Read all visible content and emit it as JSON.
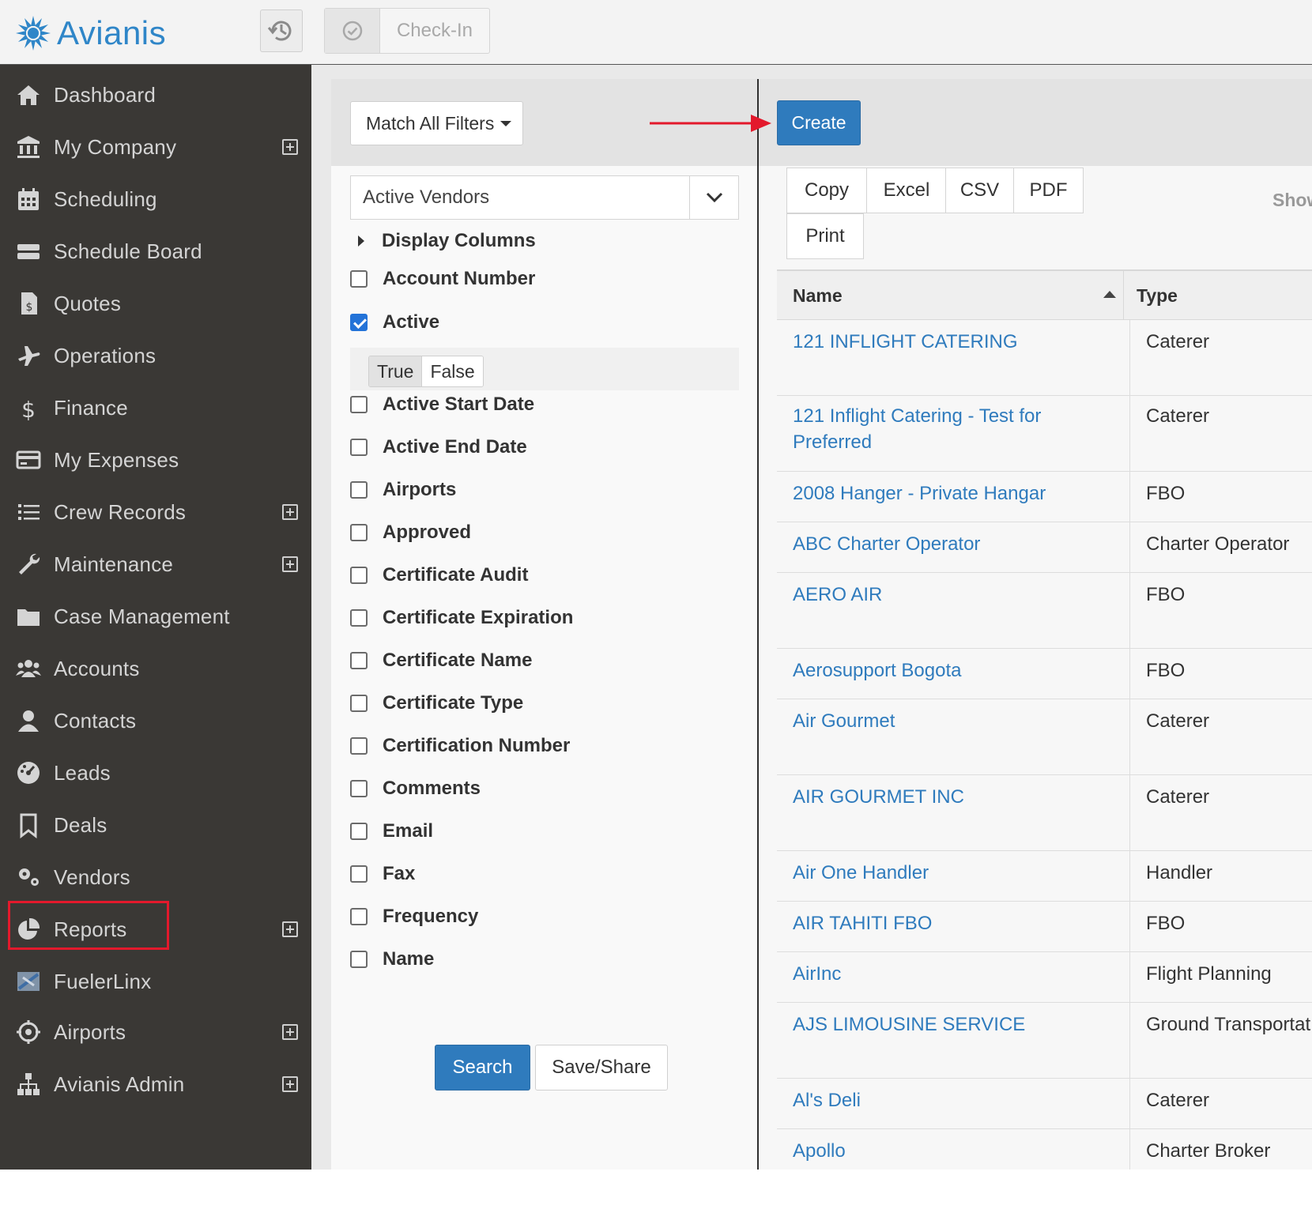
{
  "header": {
    "logo_text": "Avianis",
    "history_icon": "history-icon",
    "checkin_label": "Check-In"
  },
  "sidebar": {
    "items": [
      {
        "label": "Dashboard",
        "icon": "home-icon",
        "expandable": false
      },
      {
        "label": "My Company",
        "icon": "bank-icon",
        "expandable": true
      },
      {
        "label": "Scheduling",
        "icon": "calendar-icon",
        "expandable": false
      },
      {
        "label": "Schedule Board",
        "icon": "server-icon",
        "expandable": false
      },
      {
        "label": "Quotes",
        "icon": "invoice-icon",
        "expandable": false
      },
      {
        "label": "Operations",
        "icon": "plane-icon",
        "expandable": false
      },
      {
        "label": "Finance",
        "icon": "dollar-icon",
        "expandable": false
      },
      {
        "label": "My Expenses",
        "icon": "credit-card-icon",
        "expandable": false
      },
      {
        "label": "Crew Records",
        "icon": "list-icon",
        "expandable": true
      },
      {
        "label": "Maintenance",
        "icon": "wrench-icon",
        "expandable": true
      },
      {
        "label": "Case Management",
        "icon": "folder-icon",
        "expandable": false
      },
      {
        "label": "Accounts",
        "icon": "users-icon",
        "expandable": false
      },
      {
        "label": "Contacts",
        "icon": "user-icon",
        "expandable": false
      },
      {
        "label": "Leads",
        "icon": "gauge-icon",
        "expandable": false
      },
      {
        "label": "Deals",
        "icon": "bookmark-icon",
        "expandable": false
      },
      {
        "label": "Vendors",
        "icon": "cogs-icon",
        "expandable": false
      },
      {
        "label": "Reports",
        "icon": "pie-chart-icon",
        "expandable": true
      },
      {
        "label": "FuelerLinx",
        "icon": "fuelerlinx-icon",
        "expandable": false
      },
      {
        "label": "Airports",
        "icon": "crosshair-icon",
        "expandable": true
      },
      {
        "label": "Avianis Admin",
        "icon": "sitemap-icon",
        "expandable": true
      }
    ]
  },
  "filters": {
    "match_label": "Match All Filters",
    "view_select": "Active Vendors",
    "display_columns_label": "Display Columns",
    "fields": [
      {
        "label": "Account Number",
        "checked": false
      },
      {
        "label": "Active",
        "checked": true
      },
      {
        "label": "Active Start Date",
        "checked": false
      },
      {
        "label": "Active End Date",
        "checked": false
      },
      {
        "label": "Airports",
        "checked": false
      },
      {
        "label": "Approved",
        "checked": false
      },
      {
        "label": "Certificate Audit",
        "checked": false
      },
      {
        "label": "Certificate Expiration",
        "checked": false
      },
      {
        "label": "Certificate Name",
        "checked": false
      },
      {
        "label": "Certificate Type",
        "checked": false
      },
      {
        "label": "Certification Number",
        "checked": false
      },
      {
        "label": "Comments",
        "checked": false
      },
      {
        "label": "Email",
        "checked": false
      },
      {
        "label": "Fax",
        "checked": false
      },
      {
        "label": "Frequency",
        "checked": false
      },
      {
        "label": "Name",
        "checked": false
      }
    ],
    "active_options": {
      "true_label": "True",
      "false_label": "False",
      "selected": "True"
    },
    "search_label": "Search",
    "save_share_label": "Save/Share"
  },
  "toolbar": {
    "create_label": "Create",
    "export_buttons": [
      "Copy",
      "Excel",
      "CSV",
      "PDF",
      "Print"
    ],
    "show_label": "Show"
  },
  "table": {
    "columns": [
      "Name",
      "Type"
    ],
    "rows": [
      {
        "name": "121 INFLIGHT CATERING",
        "type": "Caterer"
      },
      {
        "name": "121 Inflight Catering - Test for Preferred",
        "type": "Caterer"
      },
      {
        "name": "2008 Hanger - Private Hangar",
        "type": "FBO"
      },
      {
        "name": "ABC Charter Operator",
        "type": "Charter Operator"
      },
      {
        "name": "AERO AIR",
        "type": "FBO"
      },
      {
        "name": "Aerosupport Bogota",
        "type": "FBO"
      },
      {
        "name": "Air Gourmet",
        "type": "Caterer"
      },
      {
        "name": "AIR GOURMET INC",
        "type": "Caterer"
      },
      {
        "name": "Air One Handler",
        "type": "Handler"
      },
      {
        "name": "AIR TAHITI FBO",
        "type": "FBO"
      },
      {
        "name": "AirInc",
        "type": "Flight Planning"
      },
      {
        "name": "AJS LIMOUSINE SERVICE",
        "type": "Ground Transportat"
      },
      {
        "name": "Al's Deli",
        "type": "Caterer"
      },
      {
        "name": "Apollo",
        "type": "Charter Broker"
      }
    ]
  },
  "colors": {
    "brand_blue": "#2f86c8",
    "primary_button": "#2f7bbd",
    "sidebar_bg": "#3a3835",
    "highlight_red": "#e3192c",
    "link_blue": "#2f7bbd"
  }
}
